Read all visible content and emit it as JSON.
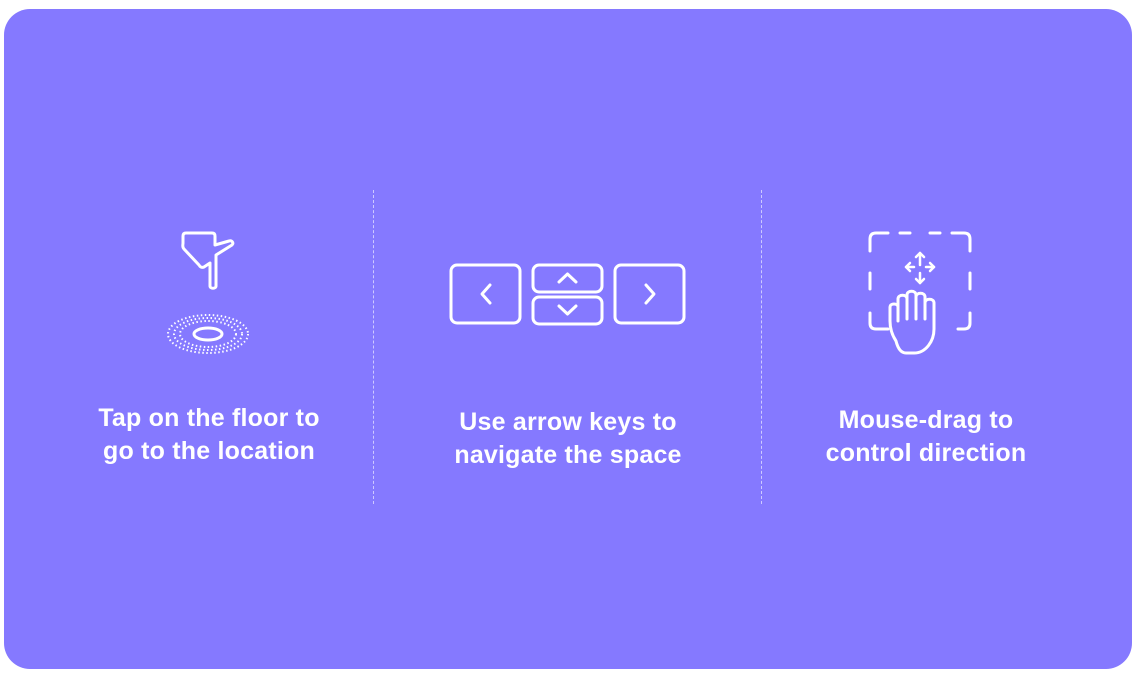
{
  "panel": {
    "background": "#8579ff",
    "foreground": "#ffffff"
  },
  "instructions": [
    {
      "icon": "tap-floor-icon",
      "lines": [
        "Tap on the floor to",
        "go to the location"
      ]
    },
    {
      "icon": "arrow-keys-icon",
      "lines": [
        "Use arrow keys to",
        "navigate the space"
      ]
    },
    {
      "icon": "mouse-drag-icon",
      "lines": [
        "Mouse-drag to",
        "control direction"
      ]
    }
  ]
}
